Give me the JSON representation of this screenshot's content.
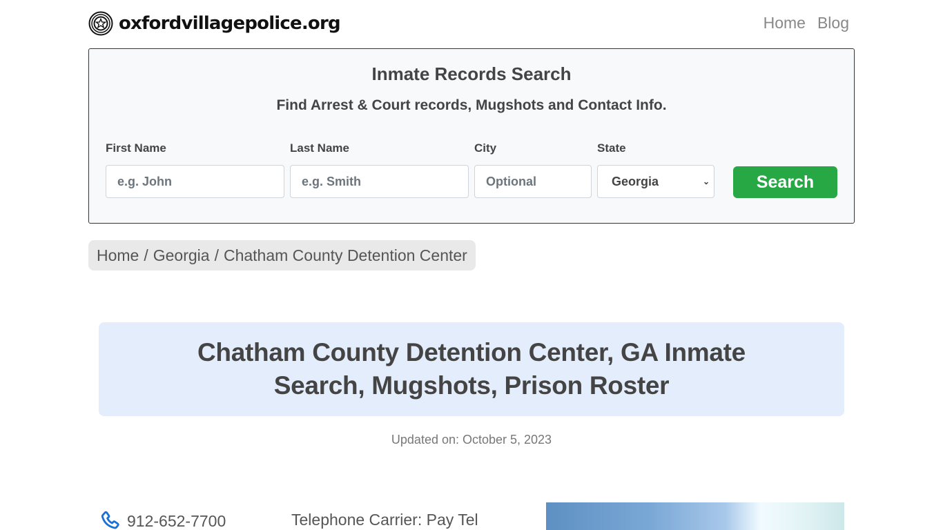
{
  "header": {
    "site_name": "oxfordvillagepolice.org",
    "logo_icon": "police-badge-star-icon",
    "nav": [
      {
        "label": "Home"
      },
      {
        "label": "Blog"
      }
    ]
  },
  "search": {
    "title": "Inmate Records Search",
    "subtitle": "Find Arrest & Court records, Mugshots and Contact Info.",
    "fields": {
      "first_name": {
        "label": "First Name",
        "placeholder": "e.g. John",
        "value": ""
      },
      "last_name": {
        "label": "Last Name",
        "placeholder": "e.g. Smith",
        "value": ""
      },
      "city": {
        "label": "City",
        "placeholder": "Optional",
        "value": ""
      },
      "state": {
        "label": "State",
        "selected": "Georgia"
      }
    },
    "button_label": "Search",
    "button_color": "#28a745"
  },
  "breadcrumb": {
    "items": [
      "Home",
      "Georgia",
      "Chatham County Detention Center"
    ],
    "separator": "/"
  },
  "page": {
    "title": "Chatham County Detention Center, GA Inmate Search, Mugshots, Prison Roster",
    "updated": "Updated on: October 5, 2023"
  },
  "contact": {
    "phone_icon": "phone-icon",
    "phone": "912-652-7700",
    "carrier": "Telephone Carrier: Pay Tel"
  }
}
